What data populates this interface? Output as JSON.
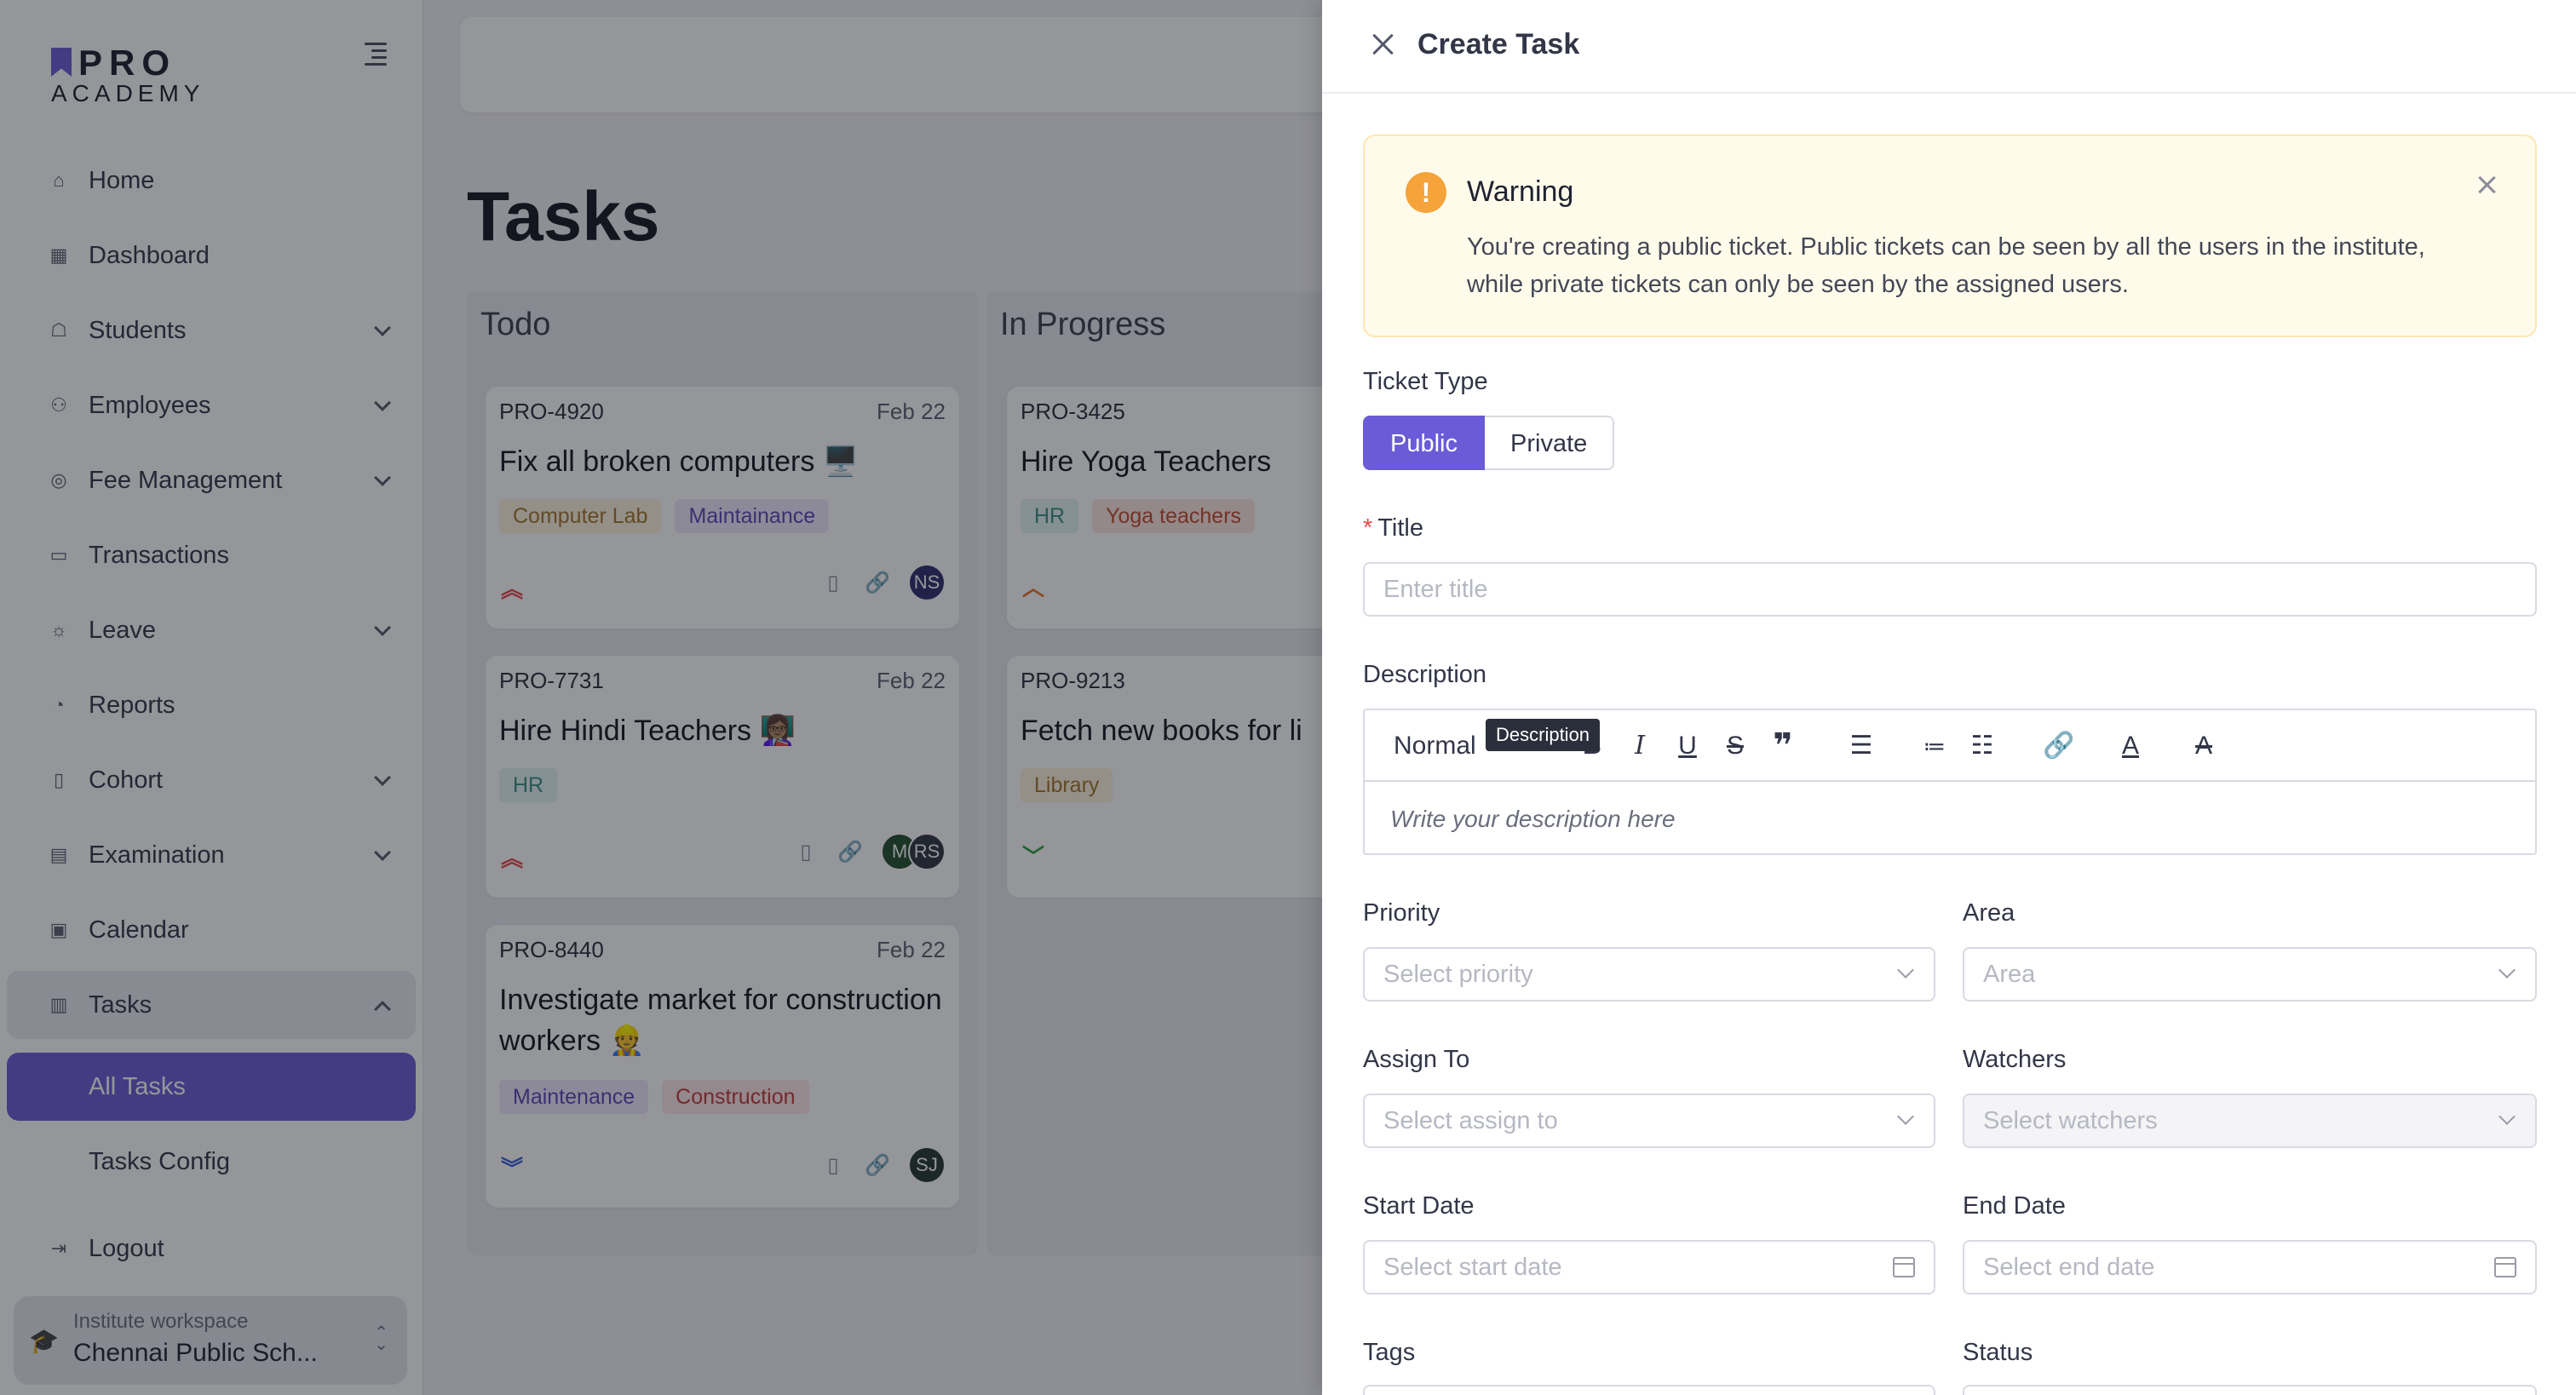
{
  "sidebar": {
    "logo_top": "PRO",
    "logo_bottom": "ACADEMY",
    "items": [
      {
        "label": "Home",
        "icon": "home-icon",
        "glyph": "⌂"
      },
      {
        "label": "Dashboard",
        "icon": "dashboard-icon",
        "glyph": "▦"
      },
      {
        "label": "Students",
        "icon": "students-icon",
        "glyph": "☖"
      },
      {
        "label": "Employees",
        "icon": "employees-icon",
        "glyph": "⚇"
      },
      {
        "label": "Fee Management",
        "icon": "fee-icon",
        "glyph": "◎"
      },
      {
        "label": "Transactions",
        "icon": "transactions-icon",
        "glyph": "▭"
      },
      {
        "label": "Leave",
        "icon": "leave-icon",
        "glyph": "☼"
      },
      {
        "label": "Reports",
        "icon": "reports-icon",
        "glyph": "◔"
      },
      {
        "label": "Cohort",
        "icon": "cohort-icon",
        "glyph": "▯"
      },
      {
        "label": "Examination",
        "icon": "examination-icon",
        "glyph": "▤"
      },
      {
        "label": "Calendar",
        "icon": "calendar-icon",
        "glyph": "▣"
      },
      {
        "label": "Tasks",
        "icon": "tasks-icon",
        "glyph": "▥"
      }
    ],
    "sub_items": [
      {
        "label": "All Tasks"
      },
      {
        "label": "Tasks Config"
      }
    ],
    "logout": "Logout",
    "workspace_caption": "Institute workspace",
    "workspace_name": "Chennai Public Sch..."
  },
  "main": {
    "title": "Tasks",
    "columns": [
      {
        "title": "Todo",
        "cards": [
          {
            "id": "PRO-4920",
            "date": "Feb 22",
            "title": "Fix all broken computers 🖥️",
            "tags": [
              "Computer Lab",
              "Maintainance"
            ],
            "priority": "high",
            "avatars": [
              "NS"
            ]
          },
          {
            "id": "PRO-7731",
            "date": "Feb 22",
            "title": "Hire Hindi Teachers 👩🏽‍🏫",
            "tags": [
              "HR"
            ],
            "priority": "high",
            "avatars": [
              "M",
              "RS"
            ]
          },
          {
            "id": "PRO-8440",
            "date": "Feb 22",
            "title": "Investigate market for construction workers 👷",
            "tags": [
              "Maintenance",
              "Construction"
            ],
            "priority": "lowest",
            "avatars": [
              "SJ"
            ]
          }
        ]
      },
      {
        "title": "In Progress",
        "cards": [
          {
            "id": "PRO-3425",
            "date": "",
            "title": "Hire Yoga Teachers",
            "tags": [
              "HR",
              "Yoga teachers"
            ],
            "priority": "medium"
          },
          {
            "id": "PRO-9213",
            "date": "",
            "title": "Fetch new books for li",
            "tags": [
              "Library"
            ],
            "priority": "low"
          }
        ]
      }
    ]
  },
  "drawer": {
    "title": "Create Task",
    "alert": {
      "title": "Warning",
      "text": "You're creating a public ticket. Public tickets can be seen by all the users in the institute, while private tickets can only be seen by the assigned users."
    },
    "ticket_type_label": "Ticket Type",
    "ticket_types": [
      "Public",
      "Private"
    ],
    "title_label": "Title",
    "title_required": "*",
    "title_placeholder": "Enter title",
    "description_label": "Description",
    "editor": {
      "format_value": "Normal",
      "tooltip": "Description",
      "placeholder": "Write your description here"
    },
    "priority_label": "Priority",
    "priority_placeholder": "Select priority",
    "area_label": "Area",
    "area_placeholder": "Area",
    "assign_label": "Assign To",
    "assign_placeholder": "Select assign to",
    "watchers_label": "Watchers",
    "watchers_placeholder": "Select watchers",
    "start_label": "Start Date",
    "start_placeholder": "Select start date",
    "end_label": "End Date",
    "end_placeholder": "Select end date",
    "tags_label": "Tags",
    "status_label": "Status"
  },
  "colors": {
    "accent": "#6b5bd6",
    "warning": "#f5a33a",
    "overlay": "rgba(20,22,32,0.45)"
  }
}
